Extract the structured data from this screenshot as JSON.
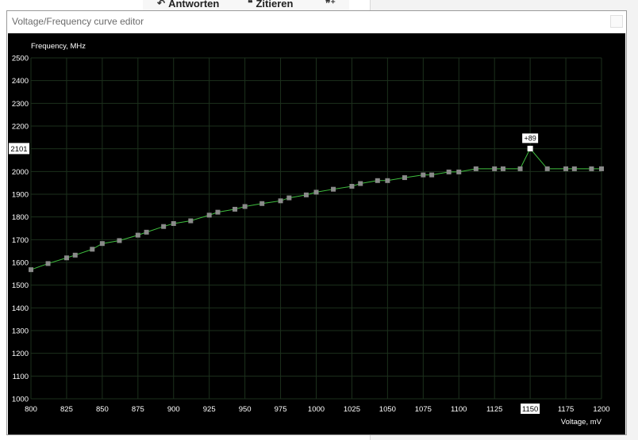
{
  "background": {
    "buttons": [
      {
        "label": "Antworten",
        "icon": "reply-icon"
      },
      {
        "label": "Zitieren",
        "icon": "quote-icon"
      }
    ]
  },
  "window": {
    "title": "Voltage/Frequency curve editor"
  },
  "chart_data": {
    "type": "line",
    "ylabel": "Frequency, MHz",
    "xlabel": "Voltage, mV",
    "xlim": [
      800,
      1200
    ],
    "ylim": [
      1000,
      2500
    ],
    "xticks": [
      800,
      825,
      850,
      875,
      900,
      925,
      950,
      975,
      1000,
      1025,
      1050,
      1075,
      1100,
      1125,
      1150,
      1175,
      1200
    ],
    "yticks": [
      1000,
      1100,
      1200,
      1300,
      1400,
      1500,
      1600,
      1700,
      1800,
      1900,
      2000,
      2100,
      2200,
      2300,
      2400,
      2500
    ],
    "grid": true,
    "colors": {
      "line": "#3fbf3f",
      "point": "#8a8a8a",
      "selected_point": "#ffffff",
      "grid": "#1c301c"
    },
    "selected": {
      "x": 1150,
      "y": 2101,
      "offset_label": "+89",
      "y_readout": "2101",
      "x_readout": "1150"
    },
    "points": [
      [
        800,
        1568
      ],
      [
        812,
        1595
      ],
      [
        825,
        1620
      ],
      [
        831,
        1632
      ],
      [
        843,
        1658
      ],
      [
        850,
        1683
      ],
      [
        862,
        1696
      ],
      [
        875,
        1720
      ],
      [
        881,
        1733
      ],
      [
        893,
        1758
      ],
      [
        900,
        1771
      ],
      [
        912,
        1783
      ],
      [
        925,
        1808
      ],
      [
        931,
        1821
      ],
      [
        943,
        1834
      ],
      [
        950,
        1846
      ],
      [
        962,
        1859
      ],
      [
        975,
        1871
      ],
      [
        981,
        1884
      ],
      [
        993,
        1897
      ],
      [
        1000,
        1909
      ],
      [
        1012,
        1922
      ],
      [
        1025,
        1935
      ],
      [
        1031,
        1947
      ],
      [
        1043,
        1960
      ],
      [
        1050,
        1960
      ],
      [
        1062,
        1973
      ],
      [
        1075,
        1985
      ],
      [
        1081,
        1985
      ],
      [
        1093,
        1998
      ],
      [
        1100,
        1998
      ],
      [
        1112,
        2012
      ],
      [
        1125,
        2012
      ],
      [
        1131,
        2012
      ],
      [
        1143,
        2012
      ],
      [
        1150,
        2101
      ],
      [
        1162,
        2012
      ],
      [
        1175,
        2012
      ],
      [
        1181,
        2012
      ],
      [
        1193,
        2012
      ],
      [
        1200,
        2012
      ]
    ]
  }
}
